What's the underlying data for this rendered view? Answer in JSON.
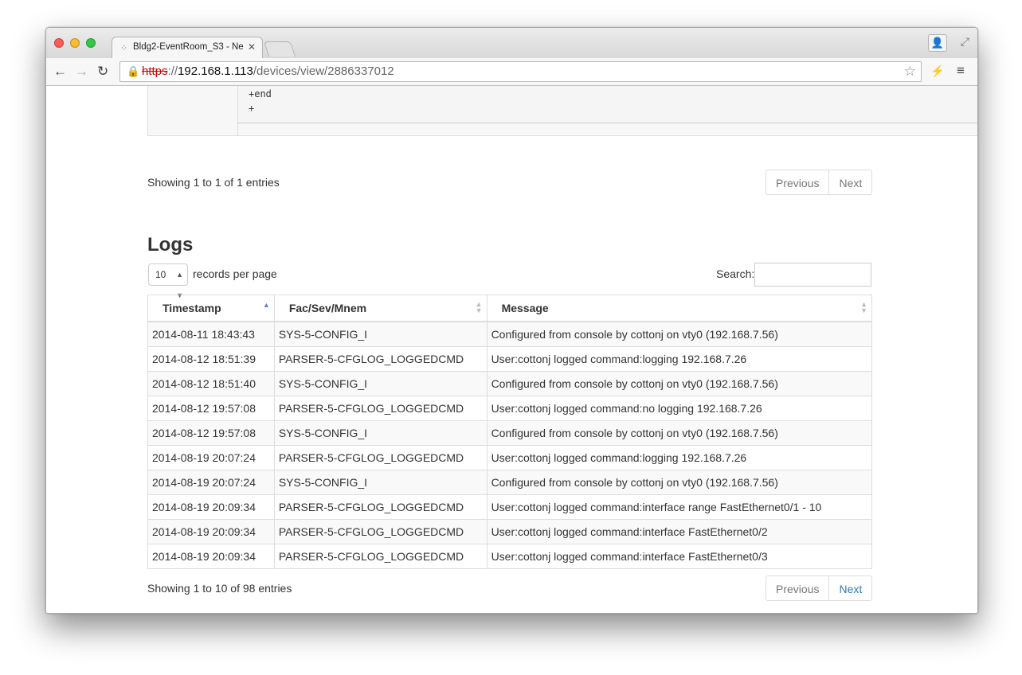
{
  "browser": {
    "tab_title": "Bldg2-EventRoom_S3 - Ne",
    "url_scheme": "https",
    "url_sep": "://",
    "url_host": "192.168.1.113",
    "url_path": "/devices/view/2886337012"
  },
  "config": {
    "lines": [
      "+end",
      "+"
    ],
    "info": "Showing 1 to 1 of 1 entries",
    "prev_label": "Previous",
    "next_label": "Next"
  },
  "logs": {
    "title": "Logs",
    "length_value": "10",
    "length_label": "records per page",
    "search_label": "Search:",
    "search_value": "",
    "columns": [
      "Timestamp",
      "Fac/Sev/Mnem",
      "Message"
    ],
    "rows": [
      [
        "2014-08-11 18:43:43",
        "SYS-5-CONFIG_I",
        "Configured from console by cottonj on vty0 (192.168.7.56)"
      ],
      [
        "2014-08-12 18:51:39",
        "PARSER-5-CFGLOG_LOGGEDCMD",
        "User:cottonj logged command:logging 192.168.7.26"
      ],
      [
        "2014-08-12 18:51:40",
        "SYS-5-CONFIG_I",
        "Configured from console by cottonj on vty0 (192.168.7.56)"
      ],
      [
        "2014-08-12 19:57:08",
        "PARSER-5-CFGLOG_LOGGEDCMD",
        "User:cottonj logged command:no logging 192.168.7.26"
      ],
      [
        "2014-08-12 19:57:08",
        "SYS-5-CONFIG_I",
        "Configured from console by cottonj on vty0 (192.168.7.56)"
      ],
      [
        "2014-08-19 20:07:24",
        "PARSER-5-CFGLOG_LOGGEDCMD",
        "User:cottonj logged command:logging 192.168.7.26"
      ],
      [
        "2014-08-19 20:07:24",
        "SYS-5-CONFIG_I",
        "Configured from console by cottonj on vty0 (192.168.7.56)"
      ],
      [
        "2014-08-19 20:09:34",
        "PARSER-5-CFGLOG_LOGGEDCMD",
        "User:cottonj logged command:interface range FastEthernet0/1 - 10"
      ],
      [
        "2014-08-19 20:09:34",
        "PARSER-5-CFGLOG_LOGGEDCMD",
        "User:cottonj logged command:interface FastEthernet0/2"
      ],
      [
        "2014-08-19 20:09:34",
        "PARSER-5-CFGLOG_LOGGEDCMD",
        "User:cottonj logged command:interface FastEthernet0/3"
      ]
    ],
    "info": "Showing 1 to 10 of 98 entries",
    "prev_label": "Previous",
    "next_label": "Next"
  },
  "colors": {
    "link_active": "#337ab7",
    "insecure_scheme": "#cc0000",
    "sort_active": "#6b7bd1"
  },
  "icons": {
    "favicon": "network-icon",
    "tab_close": "close-icon",
    "back": "arrow-left-icon",
    "forward": "arrow-right-icon",
    "reload": "reload-icon",
    "lock": "insecure-lock-icon",
    "bookmark": "star-icon",
    "extension": "extension-icon",
    "menu": "hamburger-menu-icon"
  }
}
